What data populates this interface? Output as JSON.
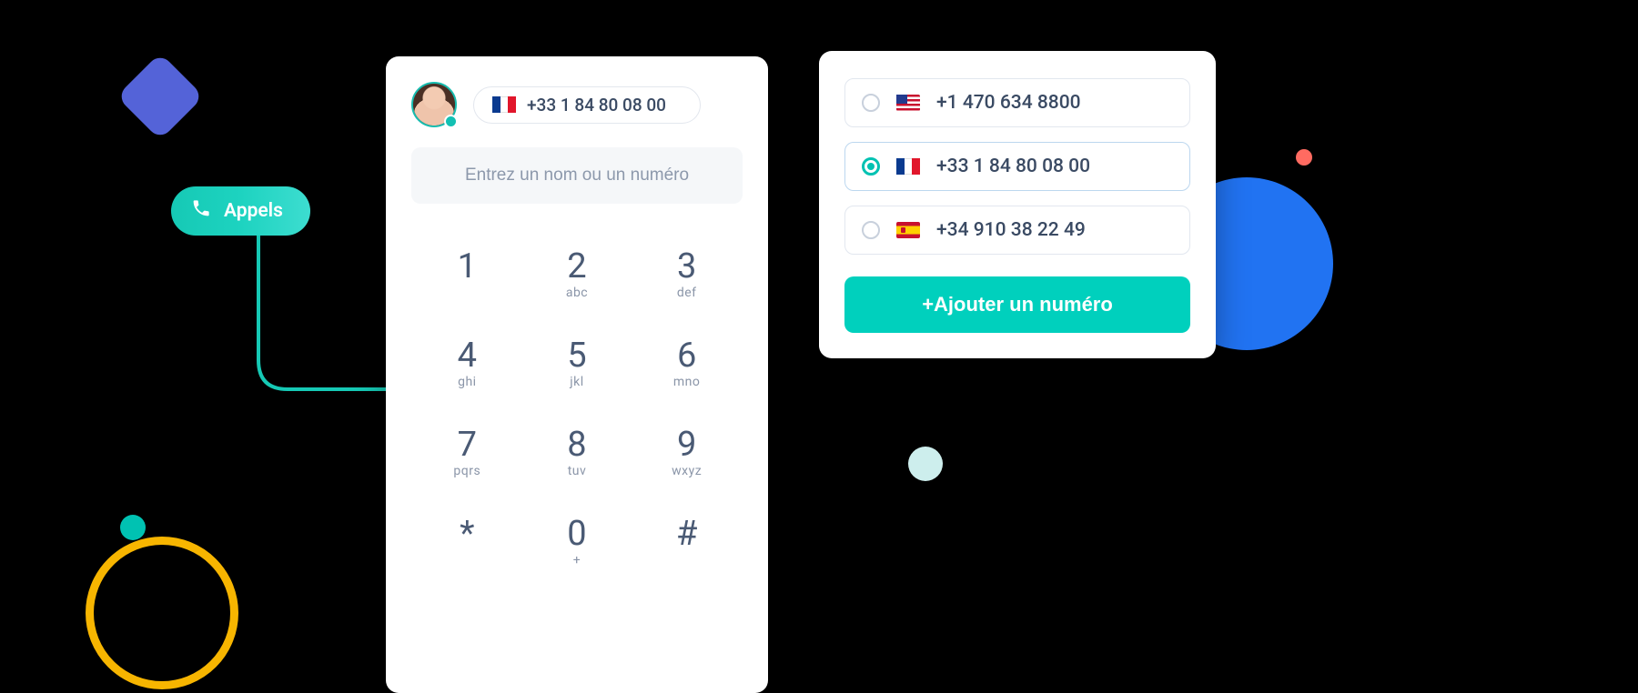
{
  "badge": {
    "label": "Appels"
  },
  "dialer": {
    "current_number": "+33 1 84 80 08 00",
    "current_flag": "fr",
    "input_placeholder": "Entrez un nom ou un numéro",
    "keys": [
      {
        "digit": "1",
        "letters": ""
      },
      {
        "digit": "2",
        "letters": "abc"
      },
      {
        "digit": "3",
        "letters": "def"
      },
      {
        "digit": "4",
        "letters": "ghi"
      },
      {
        "digit": "5",
        "letters": "jkl"
      },
      {
        "digit": "6",
        "letters": "mno"
      },
      {
        "digit": "7",
        "letters": "pqrs"
      },
      {
        "digit": "8",
        "letters": "tuv"
      },
      {
        "digit": "9",
        "letters": "wxyz"
      },
      {
        "digit": "*",
        "letters": ""
      },
      {
        "digit": "0",
        "letters": "+"
      },
      {
        "digit": "#",
        "letters": ""
      }
    ]
  },
  "number_list": {
    "options": [
      {
        "flag": "us",
        "number": "+1 470 634 8800",
        "selected": false
      },
      {
        "flag": "fr",
        "number": "+33 1 84 80 08 00",
        "selected": true
      },
      {
        "flag": "es",
        "number": "+34 910 38 22 49",
        "selected": false
      }
    ],
    "add_label": "+Ajouter un numéro"
  },
  "colors": {
    "accent_teal": "#00d0bd",
    "accent_blue": "#2173f2",
    "accent_indigo": "#5463d8",
    "accent_yellow": "#f7b500",
    "accent_coral": "#ff6b61"
  }
}
